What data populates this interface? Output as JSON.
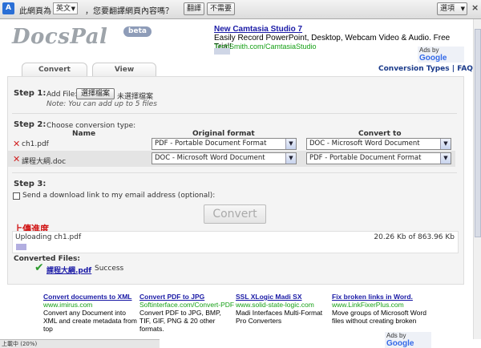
{
  "translate_bar": {
    "icon": "translate-icon",
    "text_this_page": "此網頁為",
    "language": "英文",
    "prompt": "，您要翻譯網頁內容嗎？",
    "translate_btn": "翻譯",
    "no_btn": "不需要",
    "options_btn": "選項",
    "close": "×"
  },
  "header": {
    "logo": "DocsPal",
    "beta": "beta"
  },
  "ad_top": {
    "title": "New Camtasia Studio 7",
    "desc": "Easily Record PowerPoint, Desktop, Webcam Video & Audio. Free Trial!",
    "url": "TechSmith.com/CamtasiaStudio",
    "ads_by": "Ads by",
    "google": "Google"
  },
  "tabs": {
    "convert": "Convert",
    "view": "View"
  },
  "top_links": {
    "conversion_types": "Conversion Types",
    "sep": "|",
    "faq": "FAQ"
  },
  "step1": {
    "label": "Step 1:",
    "add_file": "Add File:",
    "choose_btn": "選擇檔案",
    "no_file": "未選擇檔案",
    "note": "Note: You can add up to 5 files"
  },
  "step2": {
    "label": "Step 2:",
    "subtitle": "Choose conversion type:",
    "col_name": "Name",
    "col_original": "Original format",
    "col_convert": "Convert to",
    "files": [
      {
        "name": "ch1.pdf",
        "original": "PDF - Portable Document Format",
        "target": "DOC - Microsoft Word Document"
      },
      {
        "name": "課程大綱.doc",
        "original": "DOC - Microsoft Word Document",
        "target": "PDF - Portable Document Format"
      }
    ]
  },
  "step3": {
    "label": "Step 3:",
    "email_option": "Send a download link to my email address (optional):",
    "convert_btn": "Convert"
  },
  "upload": {
    "title": "上傳進度",
    "status": "Uploading ch1.pdf",
    "size": "20.26 Kb of 863.96 Kb",
    "progress": 0.023
  },
  "converted": {
    "title": "Converted Files:",
    "file": "課程大綱.pdf",
    "status": "Success"
  },
  "ads_bottom": [
    {
      "title": "Convert documents to XML",
      "url": "www.imirus.com",
      "desc": "Convert any Document into XML and create metadata from top"
    },
    {
      "title": "Convert PDF to JPG",
      "url": "Softinterface.com/Convert-PDF-",
      "desc": "Convert PDF to JPG, BMP, TIF, GIF, PNG & 20 other formats."
    },
    {
      "title": "SSL XLogic Madi SX",
      "url": "www.solid-state-logic.com",
      "desc": "Madi Interfaces Multi-Format Pro Converters"
    },
    {
      "title": "Fix broken links in Word.",
      "url": "www.LinkFixerPlus.com",
      "desc": "Move groups of Microsoft Word files without creating broken"
    }
  ],
  "ads_bottom_by": "Ads by",
  "ads_bottom_google": "Google",
  "status_bar": "上載中 (20%)"
}
